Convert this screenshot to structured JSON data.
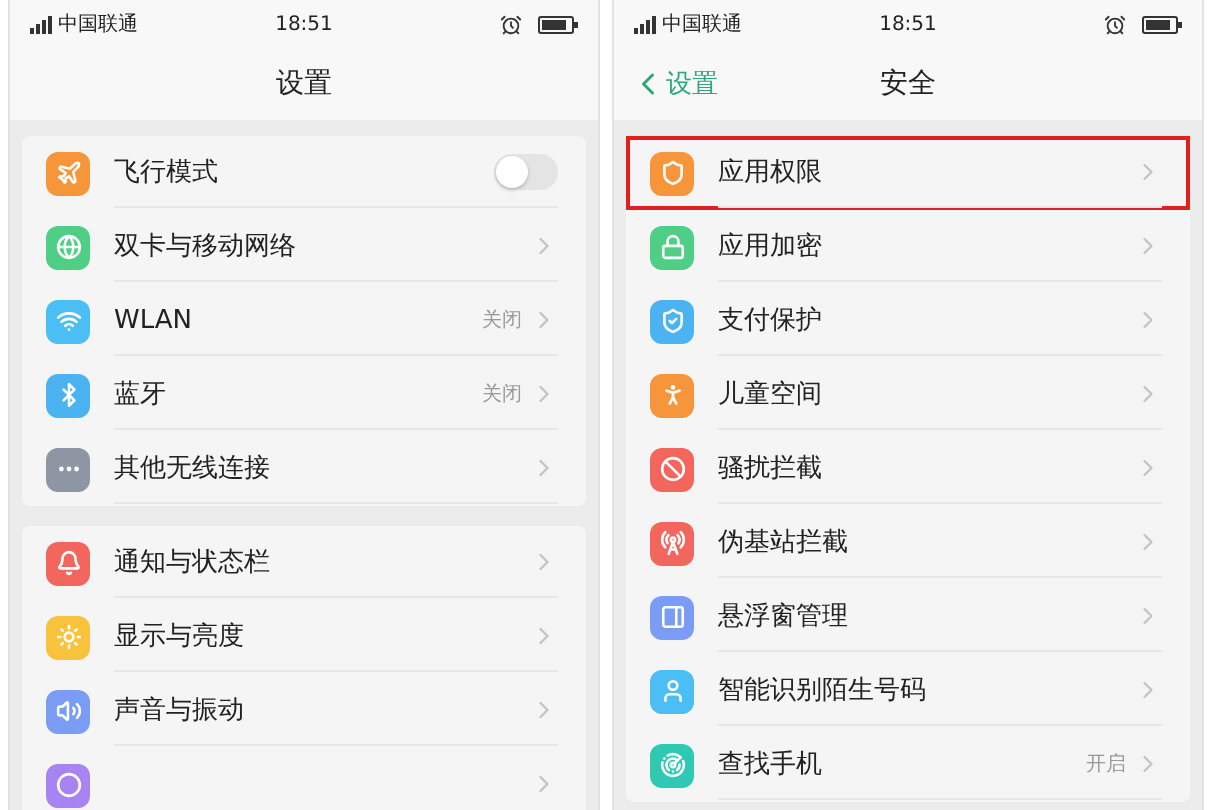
{
  "screens": [
    {
      "status_bar": {
        "carrier": "中国联通",
        "time": "18:51"
      },
      "nav": {
        "title": "设置"
      },
      "groups": [
        {
          "items": [
            {
              "kind": "toggle",
              "label": "飞行模式",
              "on": false,
              "color": "#f7953a"
            },
            {
              "kind": "link",
              "label": "双卡与移动网络",
              "color": "#4fcf86"
            },
            {
              "kind": "link",
              "label": "WLAN",
              "value": "关闭",
              "color": "#4bbef5"
            },
            {
              "kind": "link",
              "label": "蓝牙",
              "value": "关闭",
              "color": "#4bb3f2"
            },
            {
              "kind": "link",
              "label": "其他无线连接",
              "color": "#8f96a3"
            }
          ]
        },
        {
          "items": [
            {
              "kind": "link",
              "label": "通知与状态栏",
              "color": "#f2665e"
            },
            {
              "kind": "link",
              "label": "显示与亮度",
              "color": "#f8c23c"
            },
            {
              "kind": "link",
              "label": "声音与振动",
              "color": "#7b9cf5"
            },
            {
              "kind": "link",
              "color": "#a784f2"
            }
          ]
        }
      ]
    },
    {
      "status_bar": {
        "carrier": "中国联通",
        "time": "18:51"
      },
      "nav": {
        "back": "设置",
        "title": "安全"
      },
      "groups": [
        {
          "items": [
            {
              "kind": "link",
              "label": "应用权限",
              "highlighted": true,
              "color": "#f7953a"
            },
            {
              "kind": "link",
              "label": "应用加密",
              "highlighted": false,
              "color": "#4fcf86"
            },
            {
              "kind": "link",
              "label": "支付保护",
              "highlighted": false,
              "color": "#4bb3f2"
            },
            {
              "kind": "link",
              "label": "儿童空间",
              "highlighted": false,
              "color": "#f7953a"
            },
            {
              "kind": "link",
              "label": "骚扰拦截",
              "highlighted": false,
              "color": "#f2665e"
            },
            {
              "kind": "link",
              "label": "伪基站拦截",
              "highlighted": false,
              "color": "#f2665e"
            },
            {
              "kind": "link",
              "label": "悬浮窗管理",
              "highlighted": false,
              "color": "#7b9cf5"
            },
            {
              "kind": "link",
              "label": "智能识别陌生号码",
              "highlighted": false,
              "color": "#4bbef5"
            },
            {
              "kind": "link",
              "label": "查找手机",
              "value": "开启",
              "highlighted": false,
              "color": "#2fc9b3"
            }
          ]
        }
      ]
    }
  ]
}
